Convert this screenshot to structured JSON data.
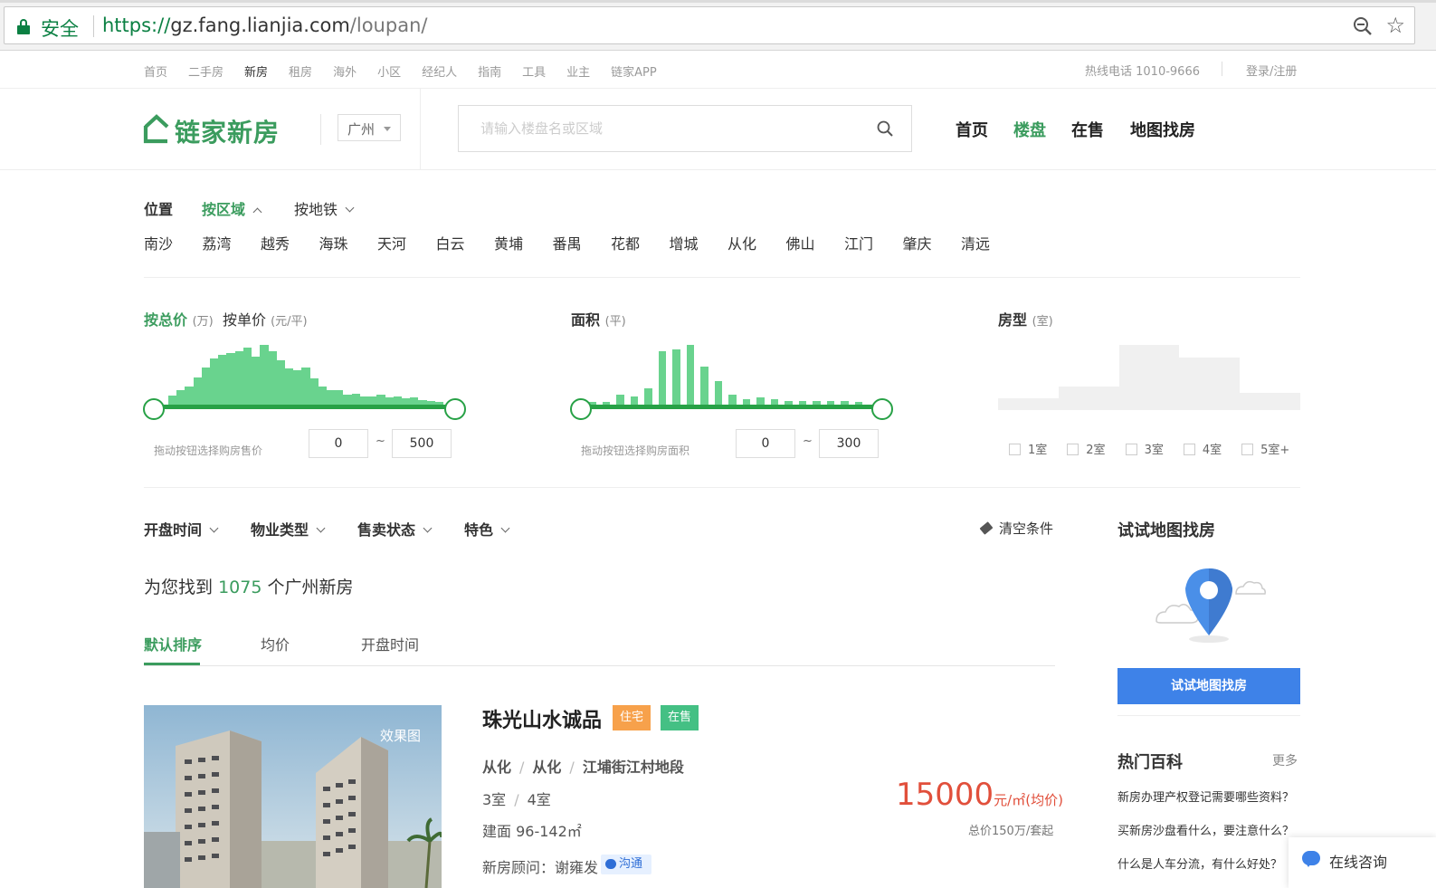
{
  "browser": {
    "secure_label": "安全",
    "url_scheme": "https://",
    "url_host": "gz.fang.lianjia.com",
    "url_path": "/loupan/"
  },
  "topnav": {
    "links": [
      "首页",
      "二手房",
      "新房",
      "租房",
      "海外",
      "小区",
      "经纪人",
      "指南",
      "工具",
      "业主",
      "链家APP"
    ],
    "active_index": 2,
    "hotline": "热线电话 1010-9666",
    "login": "登录/注册"
  },
  "header": {
    "logo_text": "链家新房",
    "city": "广州",
    "search_placeholder": "请输入楼盘名或区域",
    "nav": [
      "首页",
      "楼盘",
      "在售",
      "地图找房"
    ],
    "nav_active": 1
  },
  "location": {
    "label": "位置",
    "tab_area": "按区域",
    "tab_subway": "按地铁",
    "districts": [
      "南沙",
      "荔湾",
      "越秀",
      "海珠",
      "天河",
      "白云",
      "黄埔",
      "番禺",
      "花都",
      "增城",
      "从化",
      "佛山",
      "江门",
      "肇庆",
      "清远"
    ]
  },
  "price": {
    "tab_total": "按总价",
    "tab_total_unit": "(万)",
    "tab_unit": "按单价",
    "tab_unit_unit": "(元/平)",
    "hint": "拖动按钮选择购房售价",
    "min": "0",
    "max": "500",
    "tilde": "~",
    "histogram": [
      0.15,
      0.25,
      0.3,
      0.45,
      0.62,
      0.78,
      0.84,
      0.86,
      0.9,
      0.95,
      0.8,
      1.0,
      0.9,
      0.75,
      0.6,
      0.58,
      0.62,
      0.44,
      0.3,
      0.24,
      0.24,
      0.16,
      0.18,
      0.14,
      0.14,
      0.16,
      0.12,
      0.14,
      0.1,
      0.12,
      0.08,
      0.06,
      0.04
    ]
  },
  "area": {
    "title": "面积",
    "unit": "(平)",
    "hint": "拖动按钮选择购房面积",
    "min": "0",
    "max": "300",
    "tilde": "~",
    "histogram": [
      0.04,
      0.05,
      0.17,
      0.13,
      0.27,
      0.9,
      0.93,
      1.0,
      0.64,
      0.4,
      0.16,
      0.09,
      0.12,
      0.09,
      0.06,
      0.06,
      0.06,
      0.06,
      0.06,
      0.05
    ]
  },
  "rooms": {
    "title": "房型",
    "unit": "(室)",
    "options": [
      "1室",
      "2室",
      "3室",
      "4室",
      "5室+"
    ],
    "histogram": [
      0.18,
      0.36,
      1.0,
      0.8,
      0.26
    ]
  },
  "filters": {
    "dropdowns": [
      "开盘时间",
      "物业类型",
      "售卖状态",
      "特色"
    ],
    "clear": "清空条件"
  },
  "result": {
    "prefix": "为您找到",
    "count": "1075",
    "suffix": "个广州新房"
  },
  "sort": {
    "options": [
      "默认排序",
      "均价",
      "开盘时间"
    ],
    "active_index": 0
  },
  "listing": {
    "image_label": "效果图",
    "title": "珠光山水诚品",
    "tags": [
      "住宅",
      "在售"
    ],
    "address": [
      "从化",
      "从化",
      "江埔街江村地段"
    ],
    "rooms": [
      "3室",
      "4室"
    ],
    "area": "建面 96-142㎡",
    "advisor": "新房顾问：谢雍发",
    "chat_label": "沟通",
    "price_value": "15000",
    "price_unit": "元/㎡(均价)",
    "total": "总价150万/套起"
  },
  "sidebar": {
    "map_title": "试试地图找房",
    "map_button": "试试地图找房",
    "wiki_title": "热门百科",
    "wiki_more": "更多",
    "wiki_items": [
      "新房办理产权登记需要哪些资料？",
      "买新房沙盘看什么，要注意什么？",
      "什么是人车分流，有什么好处？"
    ]
  },
  "consult": {
    "label": "在线咨询"
  },
  "colors": {
    "brand_green": "#3b9c5e",
    "price_red": "#e14f3b",
    "button_blue": "#3e82e8"
  }
}
